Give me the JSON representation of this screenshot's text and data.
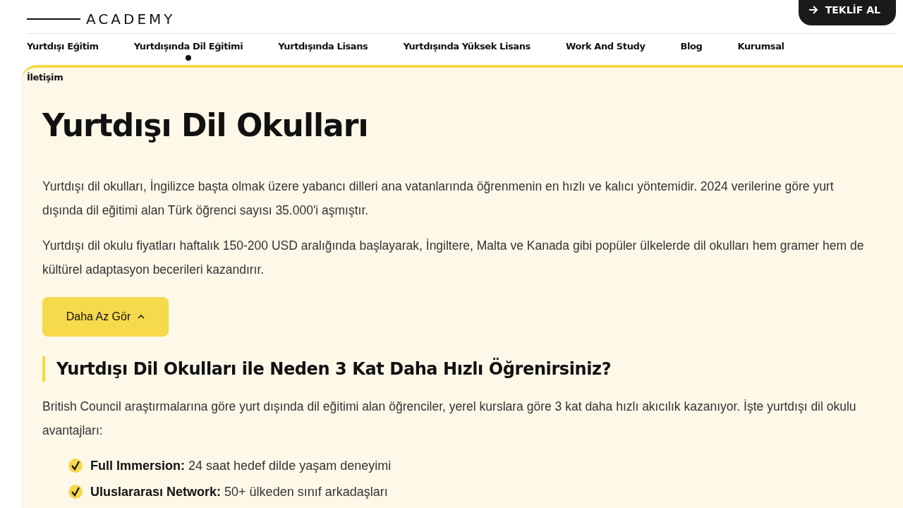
{
  "header": {
    "logo_text": "ACADEMY",
    "cta": "TEKLİF AL"
  },
  "nav": [
    {
      "label": "Yurtdışı Eğitim",
      "selected": false
    },
    {
      "label": "Yurtdışında Dil Eğitimi",
      "selected": true
    },
    {
      "label": "Yurtdışında Lisans",
      "selected": false
    },
    {
      "label": "Yurtdışında Yüksek Lisans",
      "selected": false
    },
    {
      "label": "Work And Study",
      "selected": false
    },
    {
      "label": "Blog",
      "selected": false
    },
    {
      "label": "Kurumsal",
      "selected": false
    },
    {
      "label": "İletişim",
      "selected": false
    }
  ],
  "content": {
    "title": "Yurtdışı Dil Okulları",
    "paragraphs": [
      "Yurtdışı dil okulları, İngilizce başta olmak üzere yabancı dilleri ana vatanlarında öğrenmenin en hızlı ve kalıcı yöntemidir. 2024 verilerine göre yurt dışında dil eğitimi alan Türk öğrenci sayısı 35.000'i aşmıştır.",
      "Yurtdışı dil okulu fiyatları haftalık 150-200 USD aralığında başlayarak, İngiltere, Malta ve Kanada gibi popüler ülkelerde dil okulları hem gramer hem de kültürel adaptasyon becerileri kazandırır."
    ],
    "toggle_button": "Daha Az Gör",
    "section": {
      "heading": "Yurtdışı Dil Okulları ile Neden 3 Kat Daha Hızlı Öğrenirsiniz?",
      "intro": "British Council araştırmalarına göre yurt dışında dil eğitimi alan öğrenciler, yerel kurslara göre 3 kat daha hızlı akıcılık kazanıyor. İşte yurtdışı dil okulu avantajları:",
      "benefits": [
        "**Full Immersion:** 24 saat hedef dilde yaşam deneyimi",
        "**Uluslararası Network:** 50+ ülkeden sınıf arkadaşları"
      ]
    }
  }
}
